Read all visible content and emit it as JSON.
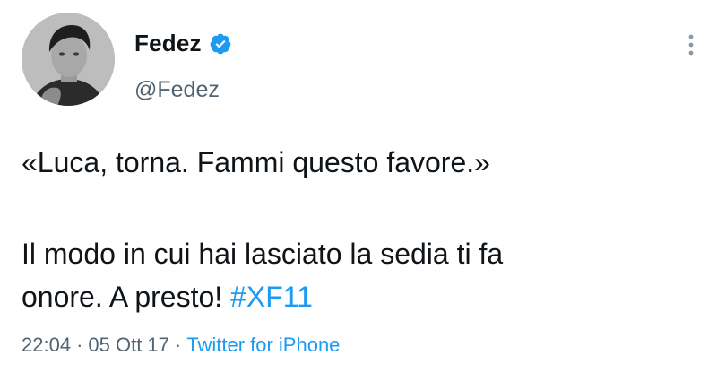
{
  "user": {
    "display_name": "Fedez",
    "handle": "@Fedez",
    "verified": true
  },
  "tweet": {
    "line1": "«Luca, torna. Fammi questo favore.»",
    "line2": "Il modo in cui hai lasciato la sedia ti fa",
    "line3_text": "onore. A presto! ",
    "hashtag": "#XF11"
  },
  "meta": {
    "time": "22:04",
    "separator": "·",
    "date": "05 Ott 17",
    "source": "Twitter for iPhone"
  },
  "colors": {
    "text": "#0f1419",
    "secondary": "#536471",
    "accent": "#1d9bf0"
  },
  "icons": [
    "verified-badge-icon",
    "more-options-icon"
  ]
}
